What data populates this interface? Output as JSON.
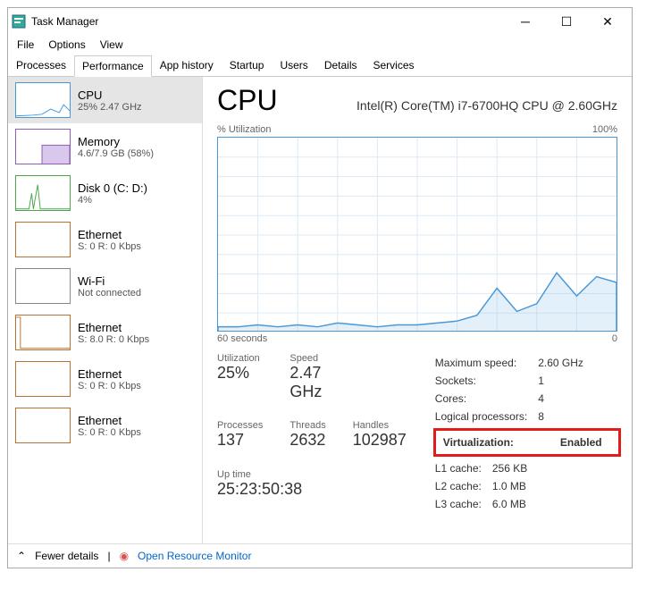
{
  "window": {
    "title": "Task Manager"
  },
  "menu": {
    "file": "File",
    "options": "Options",
    "view": "View"
  },
  "tabs": {
    "processes": "Processes",
    "performance": "Performance",
    "app_history": "App history",
    "startup": "Startup",
    "users": "Users",
    "details": "Details",
    "services": "Services"
  },
  "sidebar": [
    {
      "title": "CPU",
      "sub": "25% 2.47 GHz"
    },
    {
      "title": "Memory",
      "sub": "4.6/7.9 GB (58%)"
    },
    {
      "title": "Disk 0 (C: D:)",
      "sub": "4%"
    },
    {
      "title": "Ethernet",
      "sub": "S: 0 R: 0 Kbps"
    },
    {
      "title": "Wi-Fi",
      "sub": "Not connected"
    },
    {
      "title": "Ethernet",
      "sub": "S: 8.0 R: 0 Kbps"
    },
    {
      "title": "Ethernet",
      "sub": "S: 0 R: 0 Kbps"
    },
    {
      "title": "Ethernet",
      "sub": "S: 0 R: 0 Kbps"
    }
  ],
  "main": {
    "title": "CPU",
    "model": "Intel(R) Core(TM) i7-6700HQ CPU @ 2.60GHz",
    "util_label": "% Utilization",
    "util_max": "100%",
    "time_label": "60 seconds",
    "time_right": "0",
    "stats": {
      "utilization": {
        "label": "Utilization",
        "value": "25%"
      },
      "speed": {
        "label": "Speed",
        "value": "2.47 GHz"
      },
      "processes": {
        "label": "Processes",
        "value": "137"
      },
      "threads": {
        "label": "Threads",
        "value": "2632"
      },
      "handles": {
        "label": "Handles",
        "value": "102987"
      },
      "uptime": {
        "label": "Up time",
        "value": "25:23:50:38"
      }
    },
    "right": {
      "max_speed": {
        "label": "Maximum speed:",
        "value": "2.60 GHz"
      },
      "sockets": {
        "label": "Sockets:",
        "value": "1"
      },
      "cores": {
        "label": "Cores:",
        "value": "4"
      },
      "logical": {
        "label": "Logical processors:",
        "value": "8"
      },
      "virtualization": {
        "label": "Virtualization:",
        "value": "Enabled"
      },
      "l1": {
        "label": "L1 cache:",
        "value": "256 KB"
      },
      "l2": {
        "label": "L2 cache:",
        "value": "1.0 MB"
      },
      "l3": {
        "label": "L3 cache:",
        "value": "6.0 MB"
      }
    }
  },
  "footer": {
    "fewer": "Fewer details",
    "resmon": "Open Resource Monitor"
  },
  "chart_data": {
    "type": "line",
    "title": "% Utilization",
    "xlabel": "60 seconds",
    "ylabel": "% Utilization",
    "ylim": [
      0,
      100
    ],
    "x_seconds_ago": [
      60,
      57,
      54,
      51,
      48,
      45,
      42,
      39,
      36,
      33,
      30,
      27,
      24,
      21,
      18,
      15,
      12,
      9,
      6,
      3,
      0
    ],
    "values": [
      2,
      2,
      3,
      2,
      3,
      2,
      4,
      3,
      2,
      3,
      3,
      4,
      5,
      8,
      22,
      10,
      14,
      30,
      18,
      28,
      25
    ]
  }
}
